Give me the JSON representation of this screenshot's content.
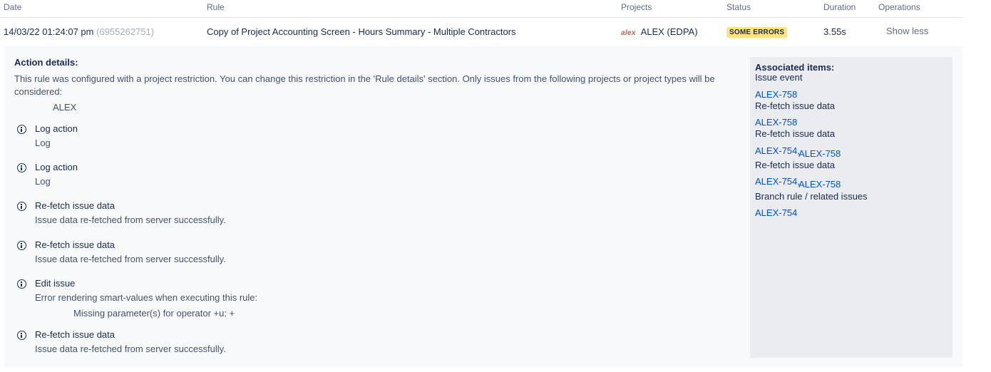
{
  "columns": {
    "date": "Date",
    "rule": "Rule",
    "projects": "Projects",
    "status": "Status",
    "duration": "Duration",
    "operations": "Operations"
  },
  "row": {
    "date": "14/03/22 01:24:07 pm",
    "execution_id": "(6955262751)",
    "rule": "Copy of Project Accounting Screen - Hours Summary - Multiple Contractors",
    "project_logo_text": "alex",
    "project": "ALEX (EDPA)",
    "status": "SOME ERRORS",
    "duration": "3.55s",
    "operation": "Show less"
  },
  "details": {
    "title": "Action details:",
    "restriction_line1": "This rule was configured with a project restriction. You can change this restriction in the 'Rule details' section. Only issues from the following projects or project types will be",
    "restriction_line2": "considered:",
    "restricted_project": "ALEX",
    "actions": [
      {
        "title": "Log action",
        "detail": "Log"
      },
      {
        "title": "Log action",
        "detail": "Log"
      },
      {
        "title": "Re-fetch issue data",
        "detail": "Issue data re-fetched from server successfully."
      },
      {
        "title": "Re-fetch issue data",
        "detail": "Issue data re-fetched from server successfully."
      },
      {
        "title": "Edit issue",
        "detail": "Error rendering smart-values when executing this rule:",
        "error": "Missing parameter(s) for operator +u: +"
      },
      {
        "title": "Re-fetch issue data",
        "detail": "Issue data re-fetched from server successfully."
      }
    ]
  },
  "associated": {
    "title": "Associated items:",
    "groups": [
      {
        "label": "Issue event",
        "links": [
          "ALEX-758"
        ]
      },
      {
        "label": "Re-fetch issue data",
        "links": [
          "ALEX-758"
        ]
      },
      {
        "label": "Re-fetch issue data",
        "links": [
          "ALEX-754,",
          "ALEX-758"
        ]
      },
      {
        "label": "Re-fetch issue data",
        "links": [
          "ALEX-754,",
          "ALEX-758"
        ]
      },
      {
        "label": "Branch rule / related issues",
        "links": [
          "ALEX-754"
        ]
      }
    ]
  },
  "colors": {
    "status_badge": "#ffe380",
    "link": "#0052cc",
    "panel": "#f8f9fa",
    "assoc_panel": "#ebecf0"
  }
}
